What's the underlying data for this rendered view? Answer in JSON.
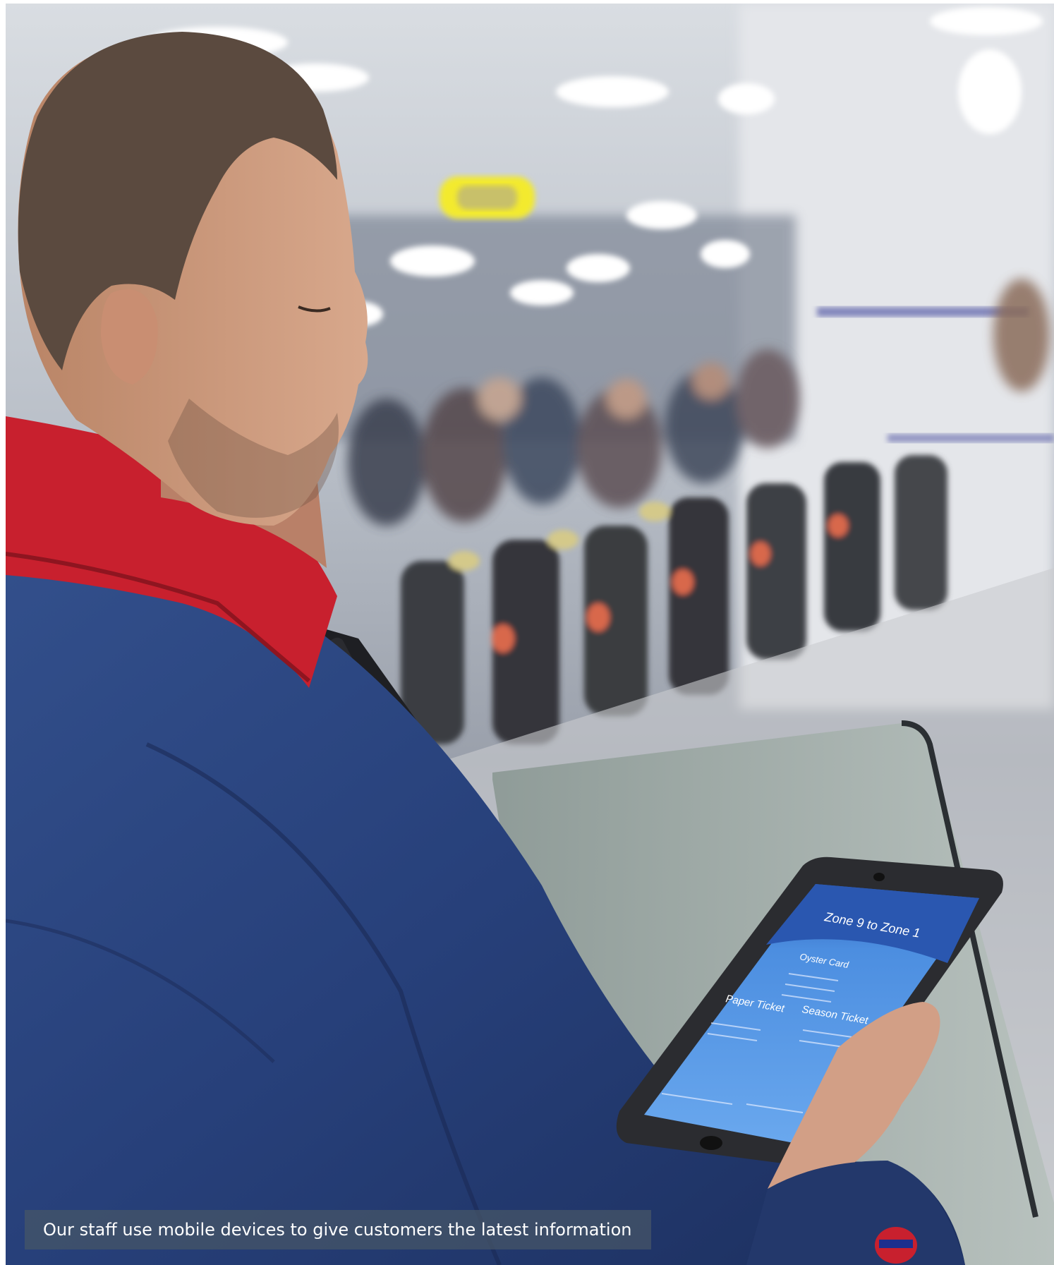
{
  "caption": {
    "text": "Our staff use mobile devices to give customers the latest information"
  },
  "tablet_screen": {
    "title": "Zone 9 to Zone 1",
    "oyster_heading": "Oyster Card",
    "paper_heading": "Paper Ticket",
    "season_heading": "Season Ticket"
  },
  "colors": {
    "caption_background": "#465666",
    "uniform_blue": "#2a3f72",
    "collar_red": "#c8202e",
    "tablet_screen_blue": "#3d7fd6"
  }
}
